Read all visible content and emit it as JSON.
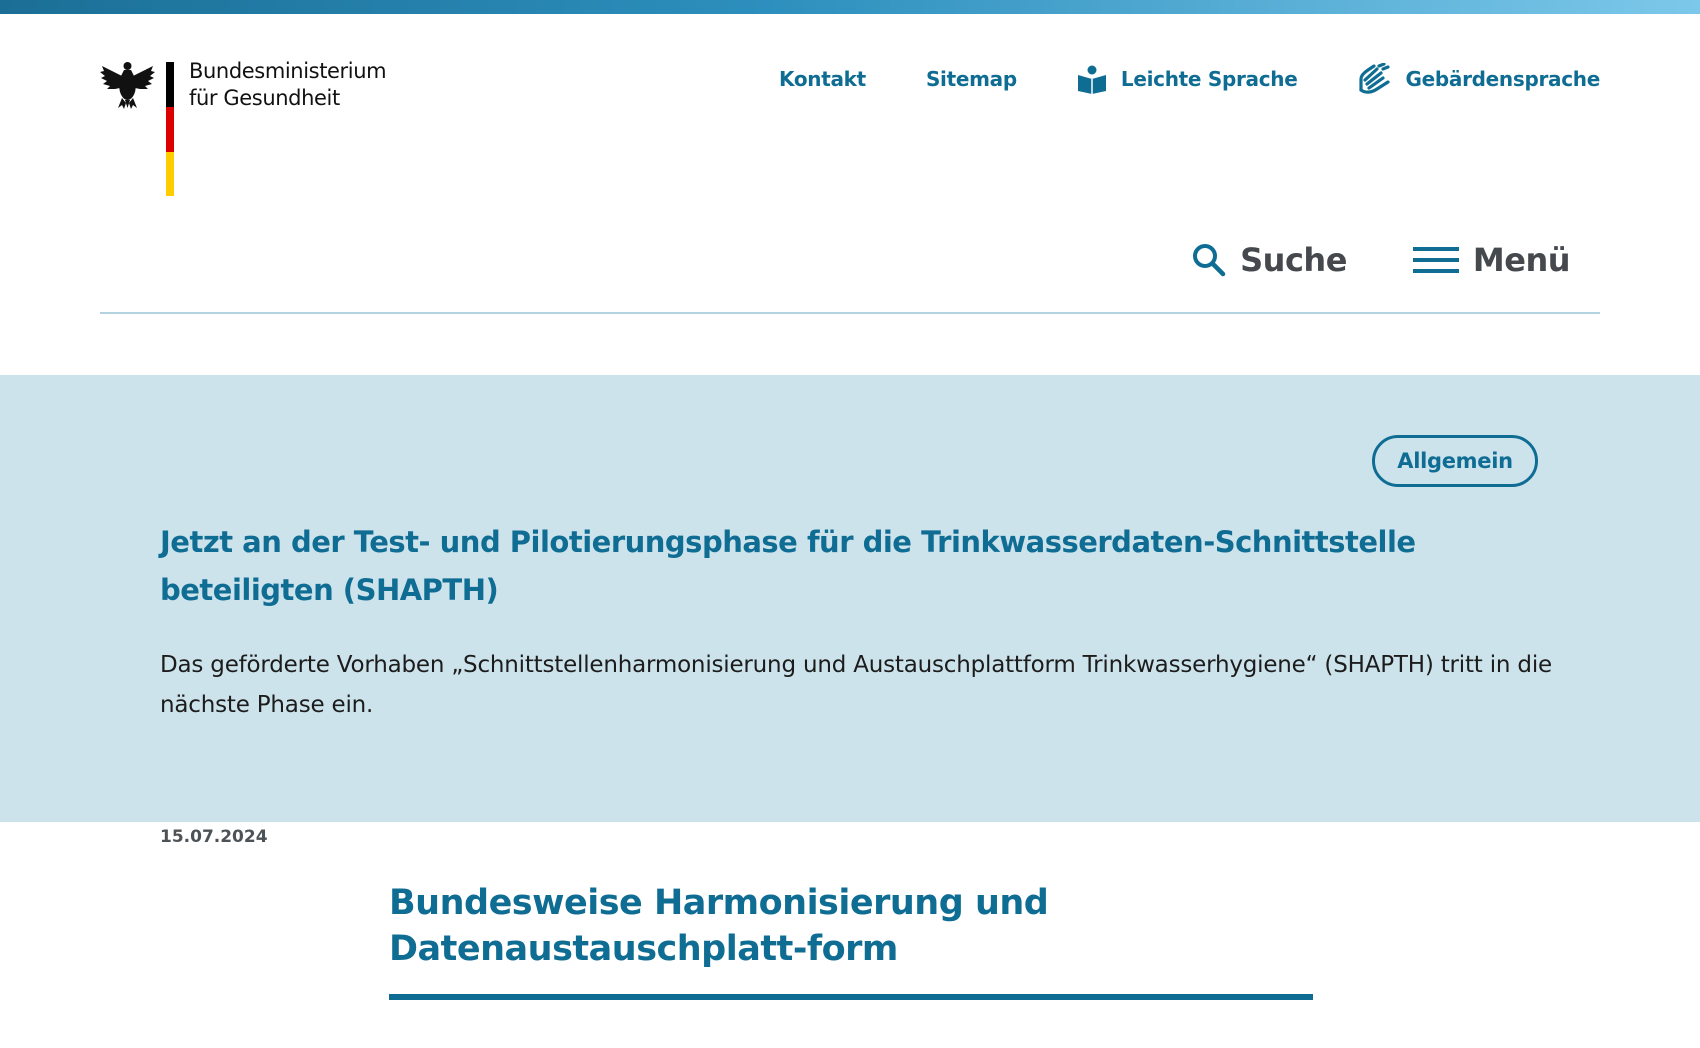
{
  "header": {
    "ministry_line1": "Bundesministerium",
    "ministry_line2": "für Gesundheit",
    "service_nav": {
      "kontakt": "Kontakt",
      "sitemap": "Sitemap",
      "leichte_sprache": "Leichte Sprache",
      "gebaerdensprache": "Gebärdensprache"
    },
    "main_nav": {
      "search": "Suche",
      "menu": "Menü"
    }
  },
  "teaser": {
    "date": "15.07.2024",
    "tag": "Allgemein",
    "title": "Jetzt an der Test- und Pilotierungsphase für die Trinkwasserdaten-Schnittstelle beteiligten (SHAPTH)",
    "text": "Das geförderte Vorhaben „Schnittstellenharmonisierung und Austauschplattform Trinkwasserhygiene“ (SHAPTH) tritt in die nächste Phase ein."
  },
  "section": {
    "title": "Bundesweise Harmonisierung und Datenaustauschplatt-form"
  },
  "colors": {
    "brand_blue": "#0f6d94",
    "teaser_bg": "#cde3ec",
    "flag_black": "#000000",
    "flag_red": "#dd0000",
    "flag_gold": "#ffcc00"
  }
}
